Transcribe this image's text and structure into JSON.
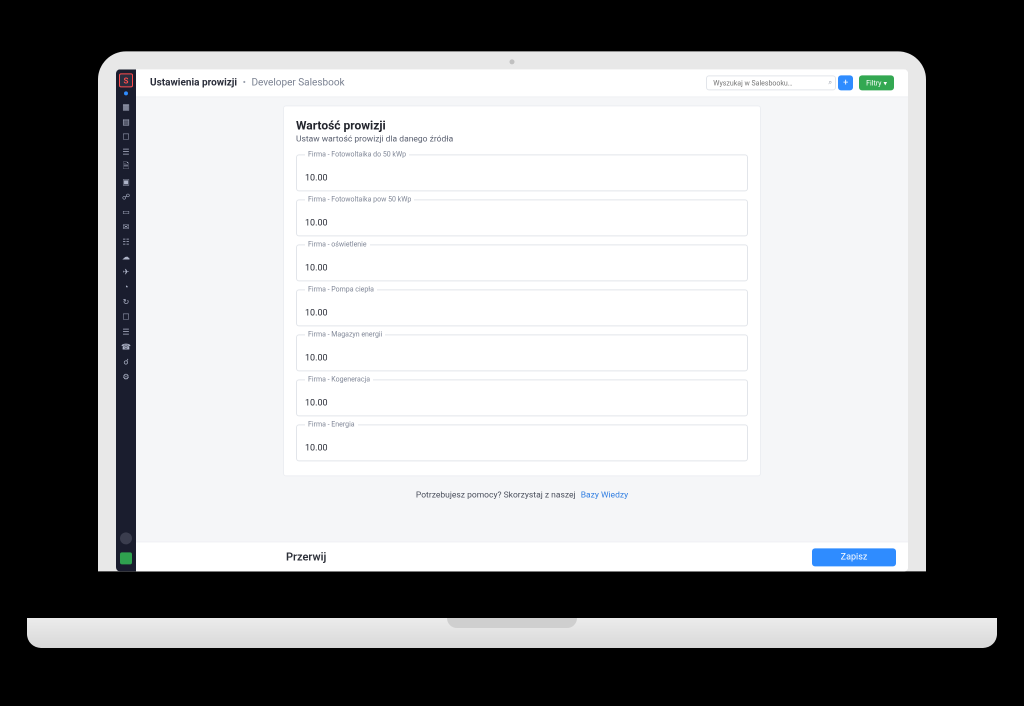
{
  "header": {
    "title": "Ustawienia prowizji",
    "separator": "•",
    "context": "Developer Salesbook",
    "search_placeholder": "Wyszukaj w Salesbooku…",
    "add_label": "+",
    "filter_label": "Filtry"
  },
  "sidebar": {
    "logo_letter": "S"
  },
  "card": {
    "title": "Wartość prowizji",
    "subtitle": "Ustaw wartość prowizji dla danego źródła",
    "fields": [
      {
        "label": "Firma - Fotowoltaika do 50 kWp",
        "value": "10.00"
      },
      {
        "label": "Firma - Fotowoltaika pow 50 kWp",
        "value": "10.00"
      },
      {
        "label": "Firma - oświetlenie",
        "value": "10.00"
      },
      {
        "label": "Firma - Pompa ciepła",
        "value": "10.00"
      },
      {
        "label": "Firma - Magazyn energii",
        "value": "10.00"
      },
      {
        "label": "Firma - Kogeneracja",
        "value": "10.00"
      },
      {
        "label": "Firma - Energia",
        "value": "10.00"
      }
    ]
  },
  "help": {
    "text": "Potrzebujesz pomocy? Skorzystaj z naszej",
    "link_label": "Bazy Wiedzy"
  },
  "footer": {
    "cancel": "Przerwij",
    "save": "Zapisz"
  }
}
